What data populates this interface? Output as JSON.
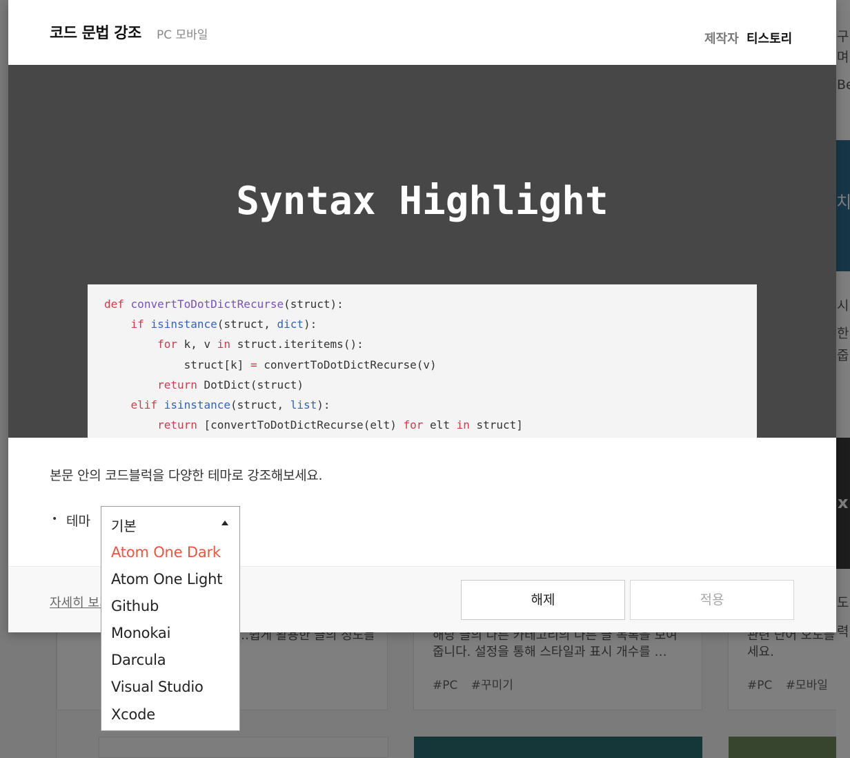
{
  "modal": {
    "title": "코드 문법 강조",
    "platform": "PC 모바일",
    "author_label": "제작자",
    "author_name": "티스토리",
    "hero_title": "Syntax Highlight",
    "description": "본문 안의 코드블럭을 다양한 테마로 강조해보세요.",
    "theme_label": "테마",
    "bullet": "•",
    "detail_link": "자세히 보기",
    "release_button": "해제",
    "apply_button": "적용"
  },
  "code": {
    "line1_kw": "def",
    "line1_fn": "convertToDotDictRecurse",
    "line1_rest": "(struct):",
    "line2_kw": "if",
    "line2_bi": "isinstance",
    "line2_mid": "(struct,",
    "line2_bi2": "dict",
    "line2_end": "):",
    "line3_kw": "for",
    "line3_mid": "k, v",
    "line3_kw2": "in",
    "line3_end": "struct.iteritems():",
    "line4_a": "struct[k]",
    "line4_op": "=",
    "line4_b": "convertToDotDictRecurse(v)",
    "line5_kw": "return",
    "line5_rest": "DotDict(struct)",
    "line6_kw": "elif",
    "line6_bi": "isinstance",
    "line6_mid": "(struct,",
    "line6_bi2": "list",
    "line6_end": "):",
    "line7_kw": "return",
    "line7_mid": "[convertToDotDictRecurse(elt)",
    "line7_kw2": "for",
    "line7_mid2": "elt",
    "line7_kw3": "in",
    "line7_end": "struct]"
  },
  "theme_select": {
    "selected": "기본",
    "options": [
      "Atom One Dark",
      "Atom One Light",
      "Github",
      "Monokai",
      "Darcula",
      "Visual Studio",
      "Xcode"
    ],
    "highlighted_index": 0,
    "highlight_color": "#f0533e"
  },
  "background": {
    "card1_text": "…쉽게 활용한 글의 정도를",
    "card2_line1": "해당 글의 다른 카테고리의 다른 글 목록을 보여",
    "card2_line2": "줍니다. 설정을 통해 스타일과 표시 개수를 …",
    "card2_tags": [
      "#PC",
      "#꾸미기"
    ],
    "card3_line1": "관련 단어 오도블럭",
    "card3_line2": "세요.",
    "card3_tags": [
      "#PC",
      "#모바일"
    ],
    "right_frag1": "구",
    "right_frag2": "며",
    "right_frag3": "Be",
    "right_frag4": "치",
    "right_frag5": "시",
    "right_frag6": "한 우",
    "right_frag7": "줍",
    "right_frag8": "x",
    "right_frag9": "도",
    "right_frag10": "력"
  },
  "colors": {
    "hero_bg": "#474747",
    "keyword": "#d23a4a",
    "function": "#7a4fc4",
    "builtin": "#3063c2",
    "accent": "#f0533e"
  }
}
